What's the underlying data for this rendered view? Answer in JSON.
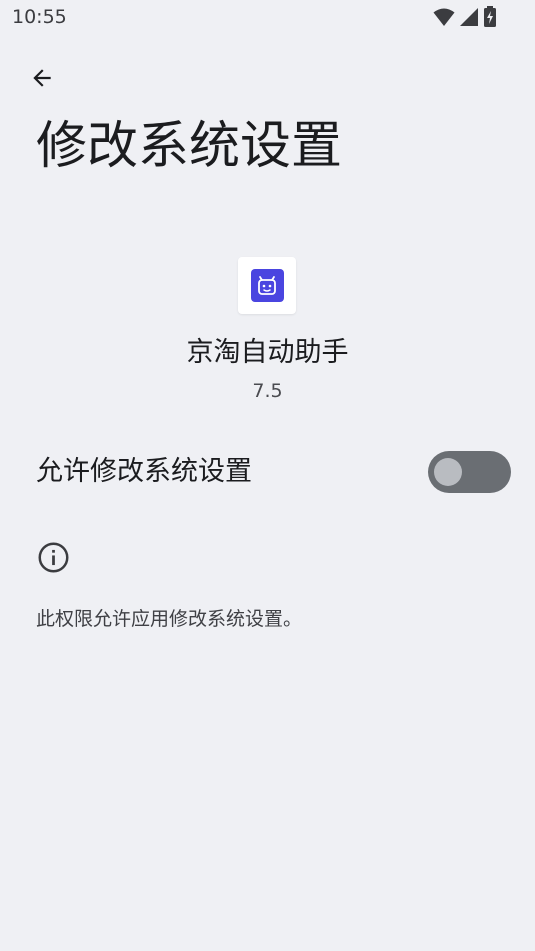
{
  "status_bar": {
    "time": "10:55",
    "icons": [
      "wifi-icon",
      "cellular-signal-icon",
      "battery-charging-icon"
    ]
  },
  "header": {
    "back_icon": "arrow-back-icon",
    "title": "修改系统设置"
  },
  "app": {
    "icon": "robot-face-icon",
    "icon_color": "#4a45e0",
    "name": "京淘自动助手",
    "version": "7.5"
  },
  "setting": {
    "label": "允许修改系统设置",
    "toggle_state": "off"
  },
  "info": {
    "icon": "info-icon",
    "text": "此权限允许应用修改系统设置。"
  }
}
